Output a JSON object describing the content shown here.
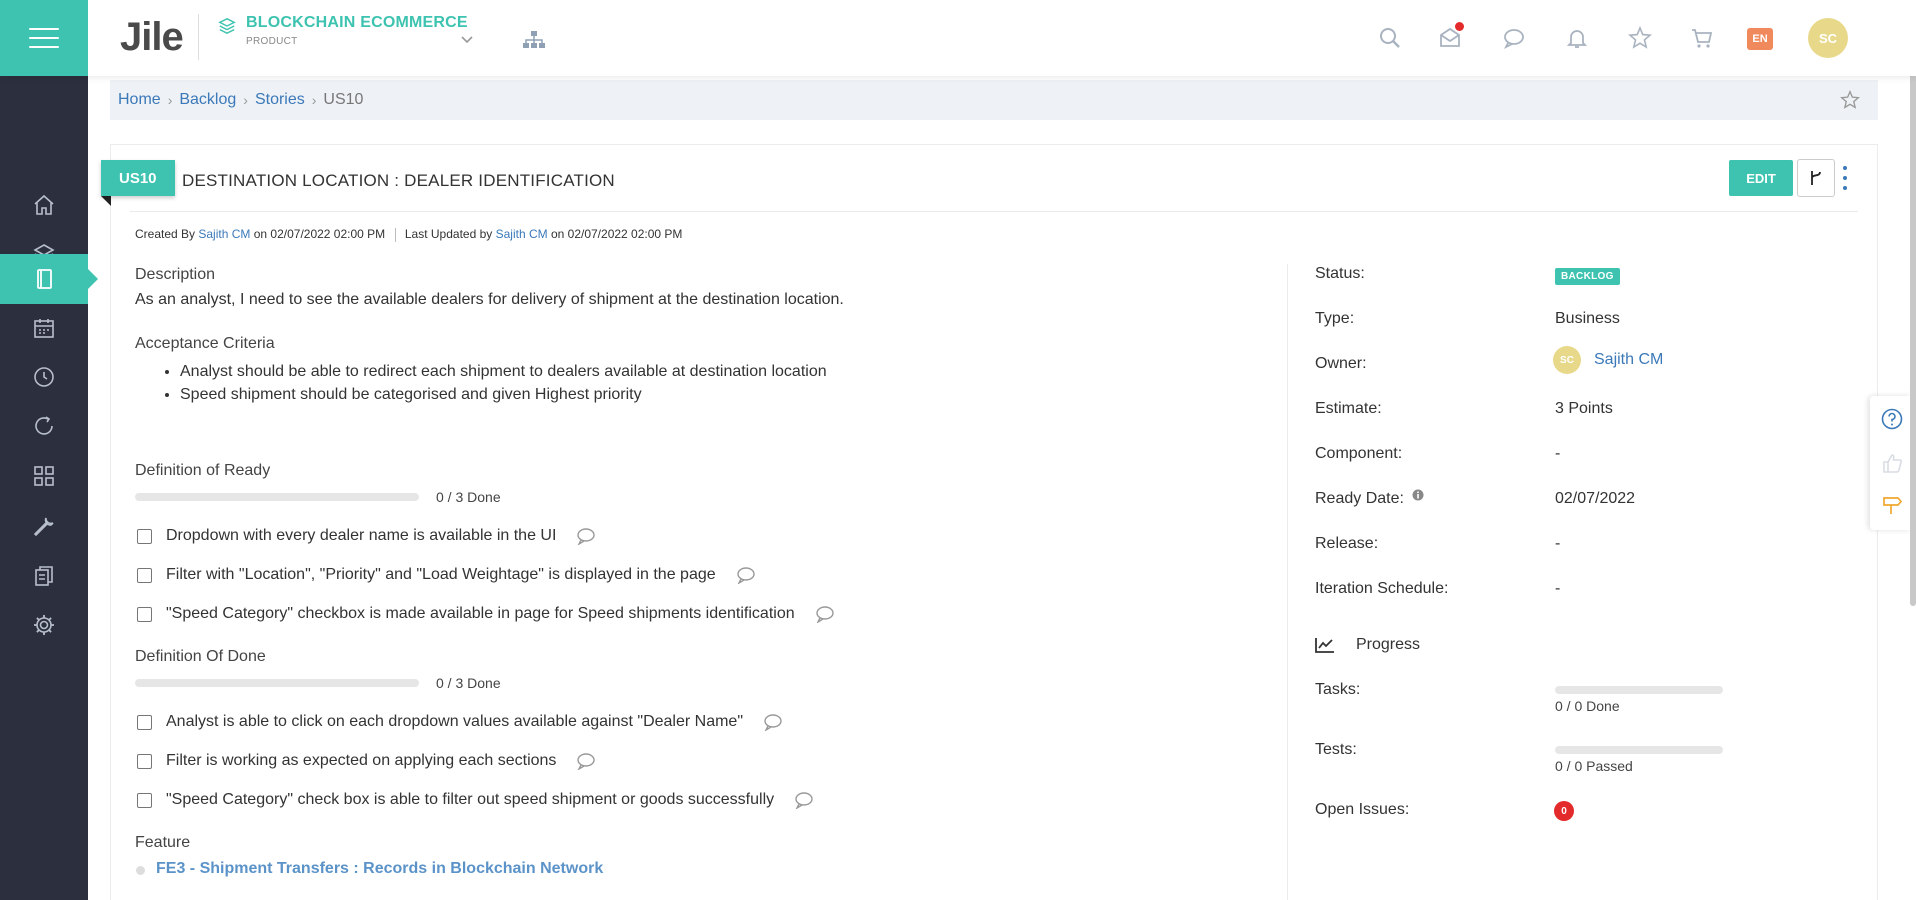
{
  "app": {
    "logo_text": "Jile",
    "product_name": "BLOCKCHAIN ECOMMERCE",
    "product_sub": "PRODUCT",
    "lang": "EN",
    "user_initials": "SC",
    "accent_color": "#3ec3b0",
    "sidebar_color": "#2c2f3e"
  },
  "header_icons": [
    "search-icon",
    "mail-icon",
    "chat-icon",
    "bell-icon",
    "star-icon",
    "cart-icon"
  ],
  "sidebar": {
    "items": [
      {
        "name": "home-icon",
        "active": false
      },
      {
        "name": "layers-icon",
        "active": false
      },
      {
        "name": "book-icon",
        "active": true
      },
      {
        "name": "calendar-icon",
        "active": false
      },
      {
        "name": "clock-icon",
        "active": false
      },
      {
        "name": "refresh-icon",
        "active": false
      },
      {
        "name": "grid-icon",
        "active": false
      },
      {
        "name": "wrench-icon",
        "active": false
      },
      {
        "name": "documents-icon",
        "active": false
      },
      {
        "name": "gear-icon",
        "active": false
      }
    ]
  },
  "breadcrumb": {
    "items": [
      "Home",
      "Backlog",
      "Stories"
    ],
    "current": "US10"
  },
  "story": {
    "id": "US10",
    "title": "DESTINATION LOCATION : DEALER IDENTIFICATION",
    "edit_label": "EDIT",
    "meta": {
      "created_prefix": "Created By",
      "created_by": "Sajith CM",
      "created_on": "on 02/07/2022 02:00 PM",
      "updated_prefix": "Last Updated by",
      "updated_by": "Sajith CM",
      "updated_on": "on 02/07/2022 02:00 PM"
    },
    "description_label": "Description",
    "description": "As an analyst, I need to see the available dealers for delivery of shipment at the destination location.",
    "acceptance_label": "Acceptance Criteria",
    "acceptance": [
      "Analyst should be able to redirect each shipment to dealers available at destination location",
      "Speed shipment should be categorised and given Highest priority"
    ],
    "dor": {
      "label": "Definition of Ready",
      "progress_text": "0 / 3 Done",
      "progress": 0,
      "items": [
        "Dropdown with every dealer name is available in the UI",
        "Filter with \"Location\", \"Priority\" and \"Load Weightage\" is displayed in the page",
        "\"Speed Category\" checkbox is made available in page for Speed shipments identification"
      ]
    },
    "dod": {
      "label": "Definition Of Done",
      "progress_text": "0 / 3 Done",
      "progress": 0,
      "items": [
        "Analyst is able to click on each dropdown values available against \"Dealer Name\"",
        "Filter is working as expected on applying each sections",
        "\"Speed Category\" check box is able to filter out speed shipment or goods successfully"
      ]
    },
    "feature_label": "Feature",
    "feature": "FE3 - Shipment Transfers : Records in Blockchain Network"
  },
  "properties": {
    "status_label": "Status:",
    "status": "BACKLOG",
    "type_label": "Type:",
    "type": "Business",
    "owner_label": "Owner:",
    "owner": "Sajith CM",
    "owner_initials": "SC",
    "estimate_label": "Estimate:",
    "estimate": "3 Points",
    "component_label": "Component:",
    "component": "-",
    "ready_date_label": "Ready Date:",
    "ready_date": "02/07/2022",
    "release_label": "Release:",
    "release": "-",
    "iteration_label": "Iteration Schedule:",
    "iteration": "-",
    "progress_label": "Progress",
    "tasks_label": "Tasks:",
    "tasks_text": "0 / 0 Done",
    "tasks_progress": 0,
    "tests_label": "Tests:",
    "tests_text": "0 / 0 Passed",
    "tests_progress": 0,
    "issues_label": "Open Issues:",
    "issues_count": "0"
  }
}
